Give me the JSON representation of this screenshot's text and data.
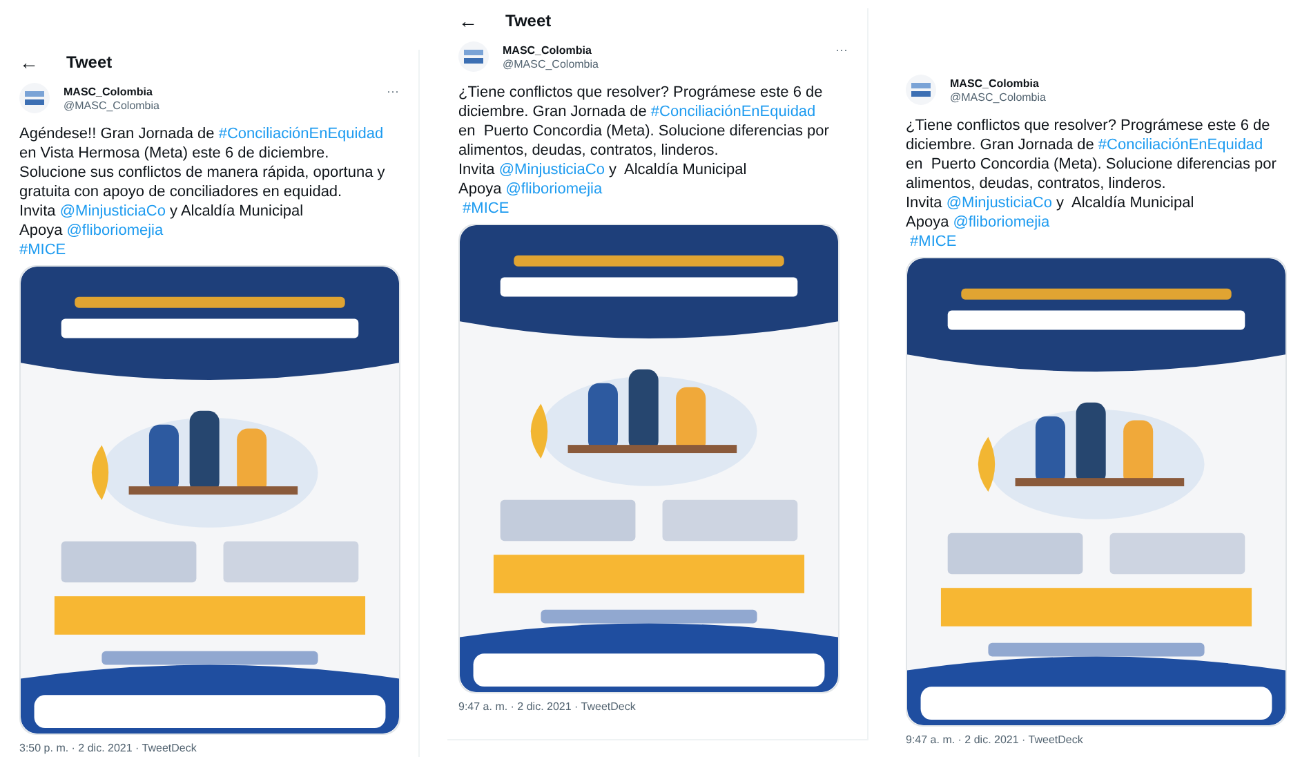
{
  "tweets": [
    {
      "header": {
        "back": "←",
        "title": "Tweet"
      },
      "author": {
        "name": "MASC_Colombia",
        "handle": "@MASC_Colombia"
      },
      "more": "···",
      "lines": [
        [
          {
            "kind": "plain",
            "text": "Agéndese!! Gran Jornada de "
          },
          {
            "kind": "link",
            "text": "#ConciliaciónEnEquidad"
          }
        ],
        [
          {
            "kind": "plain",
            "text": "en Vista Hermosa (Meta) este 6 de diciembre."
          }
        ],
        [
          {
            "kind": "plain",
            "text": "Solucione sus conflictos de manera rápida, oportuna y"
          }
        ],
        [
          {
            "kind": "plain",
            "text": "gratuita con apoyo de conciliadores en equidad."
          }
        ],
        [
          {
            "kind": "plain",
            "text": "Invita "
          },
          {
            "kind": "link",
            "text": "@MinjusticiaCo"
          },
          {
            "kind": "plain",
            "text": " y Alcaldía Municipal"
          }
        ],
        [
          {
            "kind": "plain",
            "text": "Apoya "
          },
          {
            "kind": "link",
            "text": "@fliboriomejia"
          }
        ],
        [
          {
            "kind": "link",
            "text": "#MICE"
          }
        ]
      ],
      "media": {
        "kind": "picture"
      },
      "timestamp": "3:50 p. m. · 2 dic. 2021 · TweetDeck"
    },
    {
      "header": {
        "back": "←",
        "title": "Tweet"
      },
      "author": {
        "name": "MASC_Colombia",
        "handle": "@MASC_Colombia"
      },
      "more": "···",
      "lines": [
        [
          {
            "kind": "plain",
            "text": "¿Tiene conflictos que resolver? Prográmese este 6 de"
          }
        ],
        [
          {
            "kind": "plain",
            "text": "diciembre. Gran Jornada de "
          },
          {
            "kind": "link",
            "text": "#ConciliaciónEnEquidad"
          }
        ],
        [
          {
            "kind": "plain",
            "text": "en  Puerto Concordia (Meta). Solucione diferencias por"
          }
        ],
        [
          {
            "kind": "plain",
            "text": "alimentos, deudas, contratos, linderos."
          }
        ],
        [
          {
            "kind": "plain",
            "text": "Invita "
          },
          {
            "kind": "link",
            "text": "@MinjusticiaCo"
          },
          {
            "kind": "plain",
            "text": " y  Alcaldía Municipal"
          }
        ],
        [
          {
            "kind": "plain",
            "text": "Apoya "
          },
          {
            "kind": "link",
            "text": "@fliboriomejia"
          }
        ],
        [
          {
            "kind": "link",
            "text": " #MICE"
          }
        ]
      ],
      "media": {
        "kind": "picture"
      },
      "timestamp": "9:47 a. m. · 2 dic. 2021 · TweetDeck"
    },
    {
      "author": {
        "name": "MASC_Colombia",
        "handle": "@MASC_Colombia"
      },
      "lines": [
        [
          {
            "kind": "plain",
            "text": "¿Tiene conflictos que resolver? Prográmese este 6 de"
          }
        ],
        [
          {
            "kind": "plain",
            "text": "diciembre. Gran Jornada de "
          },
          {
            "kind": "link",
            "text": "#ConciliaciónEnEquidad"
          }
        ],
        [
          {
            "kind": "plain",
            "text": "en  Puerto Concordia (Meta). Solucione diferencias por"
          }
        ],
        [
          {
            "kind": "plain",
            "text": "alimentos, deudas, contratos, linderos."
          }
        ],
        [
          {
            "kind": "plain",
            "text": "Invita "
          },
          {
            "kind": "link",
            "text": "@MinjusticiaCo"
          },
          {
            "kind": "plain",
            "text": " y  Alcaldía Municipal"
          }
        ],
        [
          {
            "kind": "plain",
            "text": "Apoya "
          },
          {
            "kind": "link",
            "text": "@fliboriomejia"
          }
        ],
        [
          {
            "kind": "link",
            "text": " #MICE"
          }
        ]
      ],
      "media": {
        "kind": "picture"
      },
      "timestamp": "9:47 a. m. · 2 dic. 2021 · TweetDeck"
    }
  ]
}
